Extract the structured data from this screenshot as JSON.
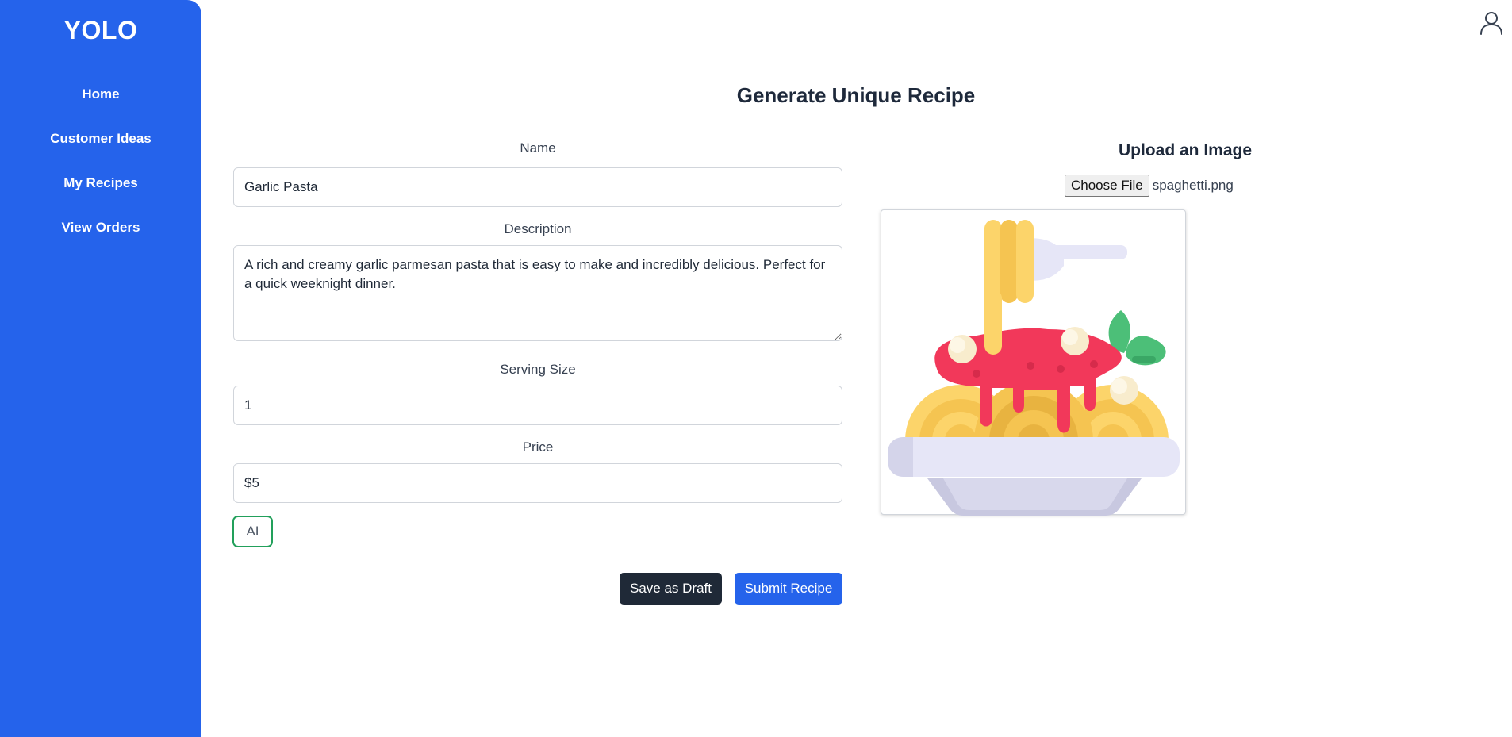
{
  "sidebar": {
    "brand": "YOLO",
    "items": [
      {
        "label": "Home"
      },
      {
        "label": "Customer Ideas"
      },
      {
        "label": "My Recipes"
      },
      {
        "label": "View Orders"
      }
    ]
  },
  "header": {
    "profile_icon": "user-icon"
  },
  "page": {
    "title": "Generate Unique Recipe"
  },
  "form": {
    "name": {
      "label": "Name",
      "value": "Garlic Pasta"
    },
    "description": {
      "label": "Description",
      "value": "A rich and creamy garlic parmesan pasta that is easy to make and incredibly delicious. Perfect for a quick weeknight dinner."
    },
    "serving_size": {
      "label": "Serving Size",
      "value": "1"
    },
    "price": {
      "label": "Price",
      "value": "$5"
    },
    "ai_button": "AI",
    "save_draft": "Save as Draft",
    "submit": "Submit Recipe"
  },
  "upload": {
    "title": "Upload an Image",
    "choose_label": "Choose File",
    "file_name": "spaghetti.png",
    "image_icon": "spaghetti-illustration"
  },
  "colors": {
    "sidebar": "#2563eb",
    "submit": "#2563eb",
    "draft": "#1f2937",
    "ai_border": "#22a05b"
  }
}
